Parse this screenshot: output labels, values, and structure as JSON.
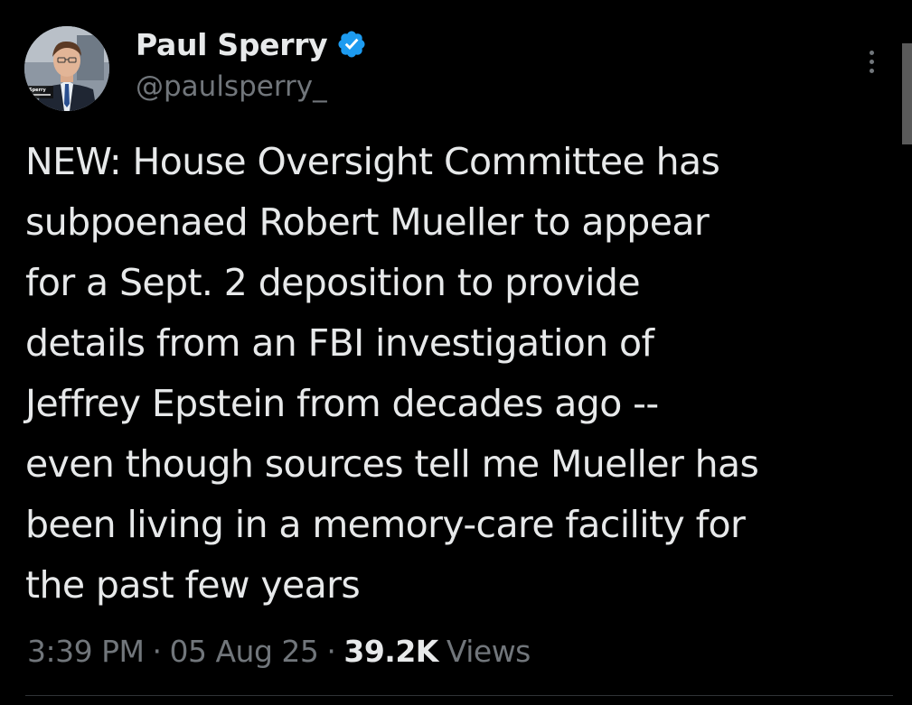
{
  "author": {
    "display_name": "Paul Sperry",
    "handle": "@paulsperry_",
    "verified_icon": "verified-badge-icon",
    "avatar_caption": "Sperry"
  },
  "tweet": {
    "text": "NEW: House Oversight Committee has\nsubpoenaed Robert Mueller to appear\nfor a Sept. 2 deposition to provide\ndetails from an FBI investigation of\nJeffrey Epstein from decades ago --\neven though sources tell me Mueller has\nbeen living in a memory-care facility for\nthe past few years"
  },
  "meta": {
    "time": "3:39 PM",
    "separator": "·",
    "date": "05 Aug 25",
    "views_count": "39.2K",
    "views_label": "Views"
  },
  "colors": {
    "background": "#000000",
    "primary_text": "#e7e9ea",
    "secondary_text": "#71767b",
    "verified_blue": "#1d9bf0"
  },
  "icons": {
    "more": "more-options-icon"
  }
}
